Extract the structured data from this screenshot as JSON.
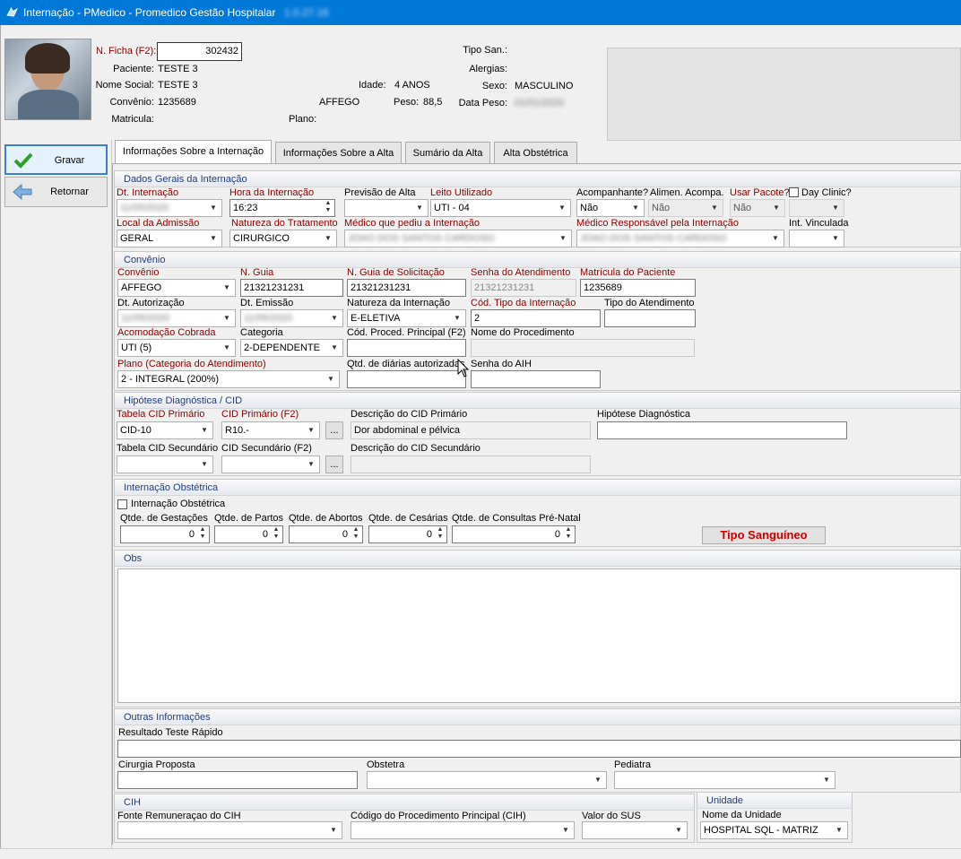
{
  "window": {
    "title": "Internação - PMedico - Promedico Gestão Hospitalar",
    "title_extra": "1.0.27.16"
  },
  "patient": {
    "ficha_label": "N. Ficha (F2):",
    "ficha_value": "302432",
    "paciente_label": "Paciente:",
    "paciente_value": "TESTE 3",
    "nome_social_label": "Nome Social:",
    "nome_social_value": "TESTE 3",
    "convenio_label": "Convênio:",
    "convenio_code": "1235689",
    "convenio_name": "AFFEGO",
    "matricula_label": "Matricula:",
    "plano_label": "Plano:",
    "idade_label": "Idade:",
    "idade_value": "4 ANOS",
    "peso_label": "Peso:",
    "peso_value": "88,5",
    "tipo_san_label": "Tipo San.:",
    "alergias_label": "Alergias:",
    "sexo_label": "Sexo:",
    "sexo_value": "MASCULINO",
    "data_peso_label": "Data Peso:",
    "data_peso_value": "01/01/2020"
  },
  "sidebar": {
    "gravar": "Gravar",
    "retornar": "Retornar"
  },
  "tabs": [
    "Informações Sobre a Internação",
    "Informações Sobre a Alta",
    "Sumário da Alta",
    "Alta Obstétrica"
  ],
  "dados_gerais": {
    "header": "Dados Gerais da Internação",
    "dt_internacao_label": "Dt. Internação",
    "dt_internacao_value": "11/05/2020",
    "hora_label": "Hora da Internação",
    "hora_value": "16:23",
    "previsao_label": "Previsão de Alta",
    "leito_label": "Leito Utilizado",
    "leito_value": "UTI - 04",
    "acompanhante_label": "Acompanhante?",
    "acompanhante_value": "Não",
    "alimen_label": "Alimen. Acompa.",
    "alimen_value": "Não",
    "pacote_label": "Usar Pacote?",
    "pacote_value": "Não",
    "day_clinic_label": "Day Clinic?",
    "local_label": "Local da Admissão",
    "local_value": "GERAL",
    "natureza_label": "Natureza do Tratamento",
    "natureza_value": "CIRURGICO",
    "medico_pediu_label": "Médico que pediu a Internação",
    "medico_pediu_value": "JOAO DOS SANTOS CARDOSO",
    "medico_resp_label": "Médico Responsável pela Internação",
    "medico_resp_value": "JOAO DOS SANTOS CARDOSO",
    "int_vinculada_label": "Int. Vinculada"
  },
  "convenio": {
    "header": "Convênio",
    "convenio_label": "Convênio",
    "convenio_value": "AFFEGO",
    "n_guia_label": "N. Guia",
    "n_guia_value": "21321231231",
    "n_guia_sol_label": "N. Guia de Solicitação",
    "n_guia_sol_value": "21321231231",
    "senha_atend_label": "Senha do Atendimento",
    "senha_atend_value": "21321231231",
    "matricula_label": "Matrícula do Paciente",
    "matricula_value": "1235689",
    "dt_autorizacao_label": "Dt. Autorização",
    "dt_autorizacao_value": "11/05/2020",
    "dt_emissao_label": "Dt. Emissão",
    "dt_emissao_value": "11/05/2020",
    "natureza_int_label": "Natureza da Internação",
    "natureza_int_value": "E-ELETIVA",
    "cod_tipo_label": "Cód. Tipo da Internação",
    "cod_tipo_value": "2",
    "tipo_atend_label": "Tipo do Atendimento",
    "acomodacao_label": "Acomodação Cobrada",
    "acomodacao_value": "UTI (5)",
    "categoria_label": "Categoria",
    "categoria_value": "2-DEPENDENTE",
    "cod_proced_label": "Cód. Proced. Principal (F2)",
    "nome_proced_label": "Nome do Procedimento",
    "plano_label": "Plano (Categoria do Atendimento)",
    "plano_value": "2 - INTEGRAL (200%)",
    "qtd_diarias_label": "Qtd. de diárias autorizadas",
    "senha_aih_label": "Senha do AIH"
  },
  "cid": {
    "header": "Hipótese Diagnóstica / CID",
    "tabela_primario_label": "Tabela CID Primário",
    "tabela_primario_value": "CID-10",
    "cid_primario_label": "CID Primário (F2)",
    "cid_primario_value": "R10.-",
    "desc_primario_label": "Descrição do CID Primário",
    "desc_primario_value": "Dor abdominal e pélvica",
    "hipotese_label": "Hipótese Diagnóstica",
    "tabela_secundario_label": "Tabela CID Secundário",
    "cid_secundario_label": "CID Secundário (F2)",
    "desc_secundario_label": "Descrição do CID Secundário",
    "ellipsis": "..."
  },
  "obstetrica": {
    "header": "Internação Obstétrica",
    "checkbox_label": "Internação Obstétrica",
    "gestacoes_label": "Qtde. de Gestações",
    "gestacoes_value": "0",
    "partos_label": "Qtde. de Partos",
    "partos_value": "0",
    "abortos_label": "Qtde. de Abortos",
    "abortos_value": "0",
    "cesarias_label": "Qtde. de Cesárias",
    "cesarias_value": "0",
    "consultas_label": "Qtde. de Consultas Pré-Natal",
    "consultas_value": "0",
    "tipo_sanguineo_button": "Tipo Sanguíneo"
  },
  "obs": {
    "header": "Obs"
  },
  "outras": {
    "header": "Outras Informações",
    "resultado_label": "Resultado Teste Rápido",
    "cirurgia_label": "Cirurgia Proposta",
    "obstetra_label": "Obstetra",
    "pediatra_label": "Pediatra"
  },
  "cih": {
    "header": "CIH",
    "fonte_label": "Fonte Remuneraçao do CIH",
    "codigo_label": "Código do Procedimento Principal (CIH)",
    "valor_label": "Valor do SUS"
  },
  "unidade": {
    "header": "Unidade",
    "nome_label": "Nome da Unidade",
    "nome_value": "HOSPITAL SQL - MATRIZ"
  },
  "colors": {
    "titlebar": "#0078d7",
    "required_label": "#8b0000",
    "group_header": "#1f3d7a",
    "tipo_sanguineo": "#cc0000"
  }
}
